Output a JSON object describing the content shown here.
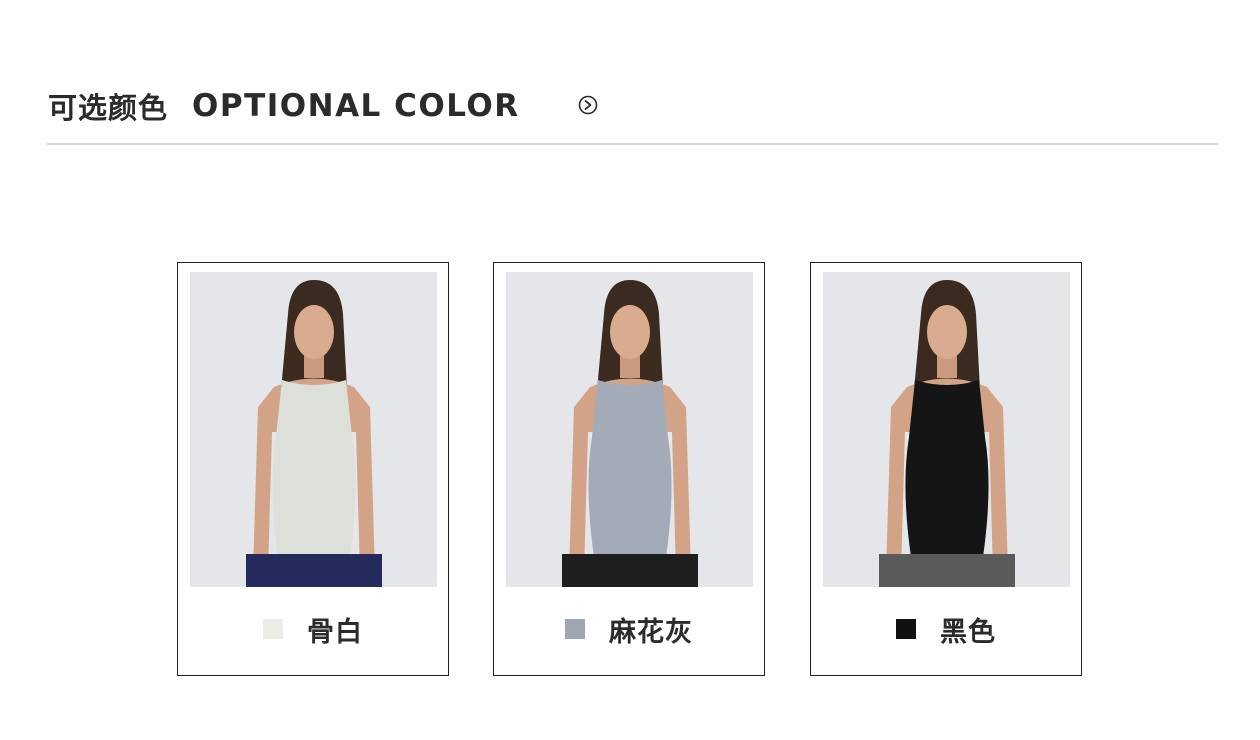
{
  "header": {
    "title_cn": "可选颜色",
    "title_en": "OPTIONAL COLOR",
    "arrow_icon": "circle-arrow-right-icon"
  },
  "colors": [
    {
      "name": "骨白",
      "swatch": "#ecede8",
      "top_color": "#dde0da",
      "bottom_color": "#242a5c"
    },
    {
      "name": "麻花灰",
      "swatch": "#9ea6b4",
      "top_color": "#a4abb8",
      "bottom_color": "#1e1e1e"
    },
    {
      "name": "黑色",
      "swatch": "#111111",
      "top_color": "#151515",
      "bottom_color": "#5a5a5a"
    }
  ]
}
